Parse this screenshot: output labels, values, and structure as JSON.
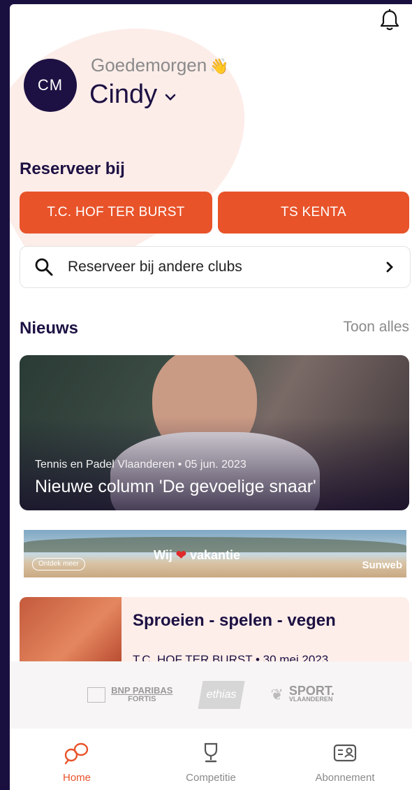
{
  "greeting": {
    "text": "Goedemorgen",
    "emoji": "👋",
    "avatar_initials": "CM",
    "username": "Cindy"
  },
  "reserve": {
    "title": "Reserveer bij",
    "clubs": [
      "T.C. HOF TER BURST",
      "TS KENTA"
    ],
    "other_clubs_label": "Reserveer bij andere clubs"
  },
  "news": {
    "title": "Nieuws",
    "see_all": "Toon alles",
    "featured": {
      "source_date": "Tennis en Padel Vlaanderen • 05 jun. 2023",
      "headline": "Nieuwe column 'De gevoelige snaar'"
    },
    "second": {
      "headline": "Sproeien - spelen - vegen",
      "source_date": "T.C. HOF TER BURST • 30 mei 2023"
    }
  },
  "ad": {
    "cta": "Ontdek meer",
    "slogan_left": "Wij",
    "slogan_right": "vakantie",
    "brand": "Sunweb"
  },
  "sponsors": {
    "bnp_line1": "BNP PARIBAS",
    "bnp_line2": "FORTIS",
    "ethias": "ethias",
    "sport_line1": "SPORT.",
    "sport_line2": "VLAANDEREN"
  },
  "tabs": [
    {
      "label": "Home",
      "icon": "home-racket-icon",
      "active": true
    },
    {
      "label": "Competitie",
      "icon": "trophy-icon",
      "active": false
    },
    {
      "label": "Abonnement",
      "icon": "membership-card-icon",
      "active": false
    }
  ],
  "colors": {
    "accent": "#e8532a",
    "navy": "#1d1143"
  }
}
